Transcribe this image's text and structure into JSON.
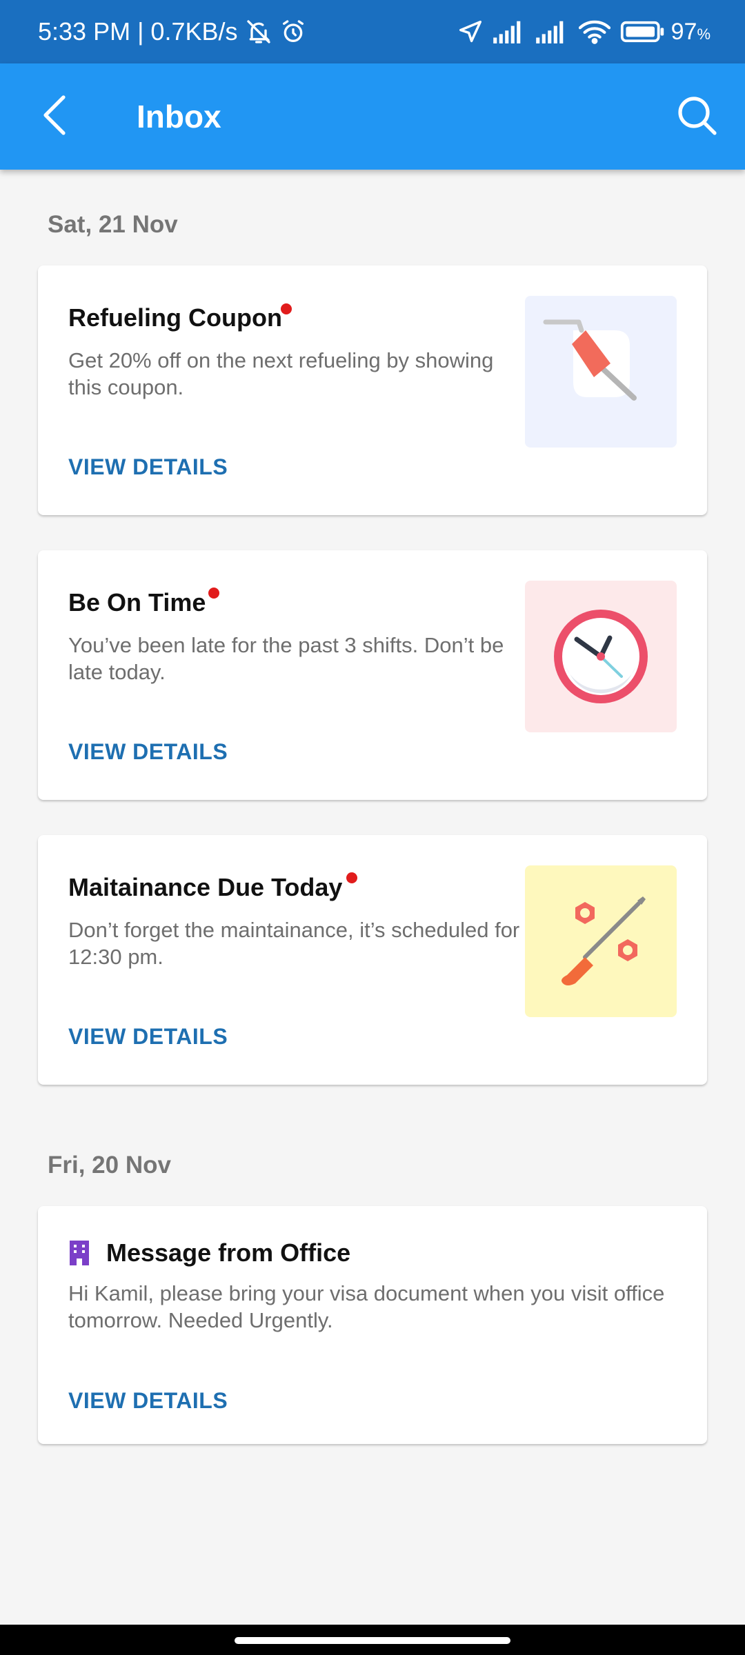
{
  "status_bar": {
    "time": "5:33 PM",
    "network_speed": "| 0.7KB/s",
    "battery": "97",
    "battery_unit": "%",
    "icons": [
      "mute-icon",
      "alarm-icon",
      "location-icon",
      "signal-icon",
      "signal-icon",
      "wifi-icon",
      "battery-icon"
    ]
  },
  "app_bar": {
    "title": "Inbox",
    "back_icon": "back-arrow-icon",
    "search_icon": "search-icon"
  },
  "sections": [
    {
      "date": "Sat, 21 Nov",
      "messages": [
        {
          "title": "Refueling Coupon",
          "unread": true,
          "body": "Get 20% off on the next refueling by showing this coupon.",
          "action": "VIEW DETAILS",
          "thumbnail": "fuel-nozzle-icon",
          "thumbnail_bg": "#eef2fe"
        },
        {
          "title": "Be On Time",
          "unread": true,
          "body": "You’ve been late for the past 3 shifts. Don’t be late today.",
          "action": "VIEW DETAILS",
          "thumbnail": "clock-icon",
          "thumbnail_bg": "#fde9ea"
        },
        {
          "title": "Maitainance Due Today",
          "unread": true,
          "body": "Don’t forget the maintainance, it’s scheduled for 12:30 pm.",
          "action": "VIEW DETAILS",
          "thumbnail": "tools-icon",
          "thumbnail_bg": "#fef8bd"
        }
      ]
    },
    {
      "date": "Fri, 20 Nov",
      "messages": [
        {
          "title": "Message from Office",
          "unread": false,
          "leading_icon": "office-building-icon",
          "body": "Hi Kamil, please bring your visa document when you visit office tomorrow. Needed Urgently.",
          "action": "VIEW DETAILS"
        }
      ]
    }
  ],
  "colors": {
    "status_bar": "#1a6fc0",
    "app_bar": "#2196f3",
    "action_link": "#1e6fb1",
    "unread_dot": "#e11c1c",
    "background": "#f5f5f5"
  }
}
